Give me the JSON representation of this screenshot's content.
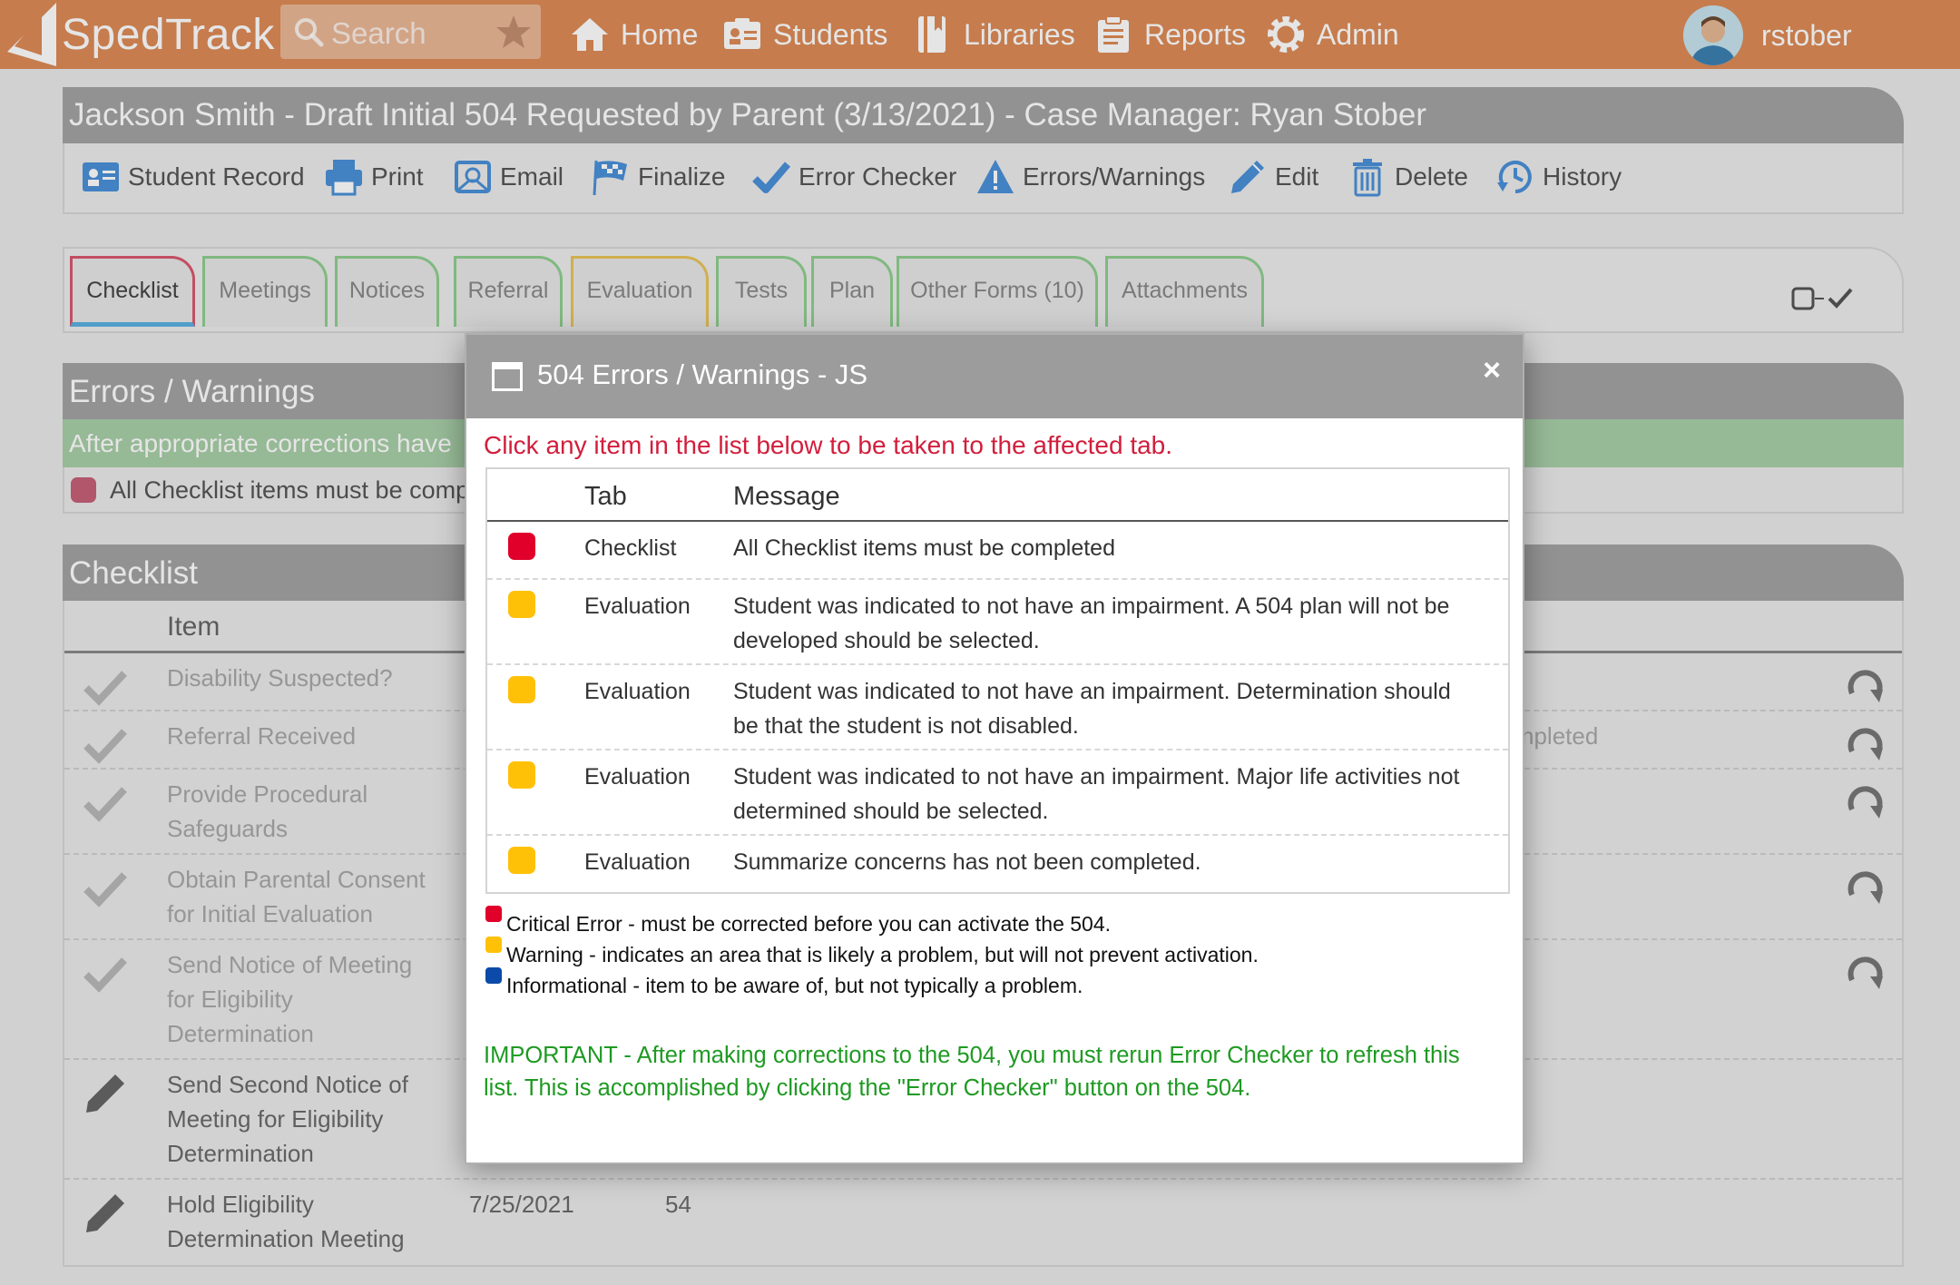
{
  "app": {
    "name": "SpedTrack",
    "search_placeholder": "Search",
    "nav": [
      {
        "label": "Home",
        "icon": "home-icon"
      },
      {
        "label": "Students",
        "icon": "students-icon"
      },
      {
        "label": "Libraries",
        "icon": "libraries-icon"
      },
      {
        "label": "Reports",
        "icon": "reports-icon"
      },
      {
        "label": "Admin",
        "icon": "admin-icon"
      }
    ],
    "user": "rstober"
  },
  "record": {
    "title": "Jackson Smith - Draft Initial 504 Requested by Parent (3/13/2021) - Case Manager: Ryan Stober",
    "toolbar": [
      {
        "label": "Student Record",
        "icon": "student-record-icon"
      },
      {
        "label": "Print",
        "icon": "print-icon"
      },
      {
        "label": "Email",
        "icon": "email-icon"
      },
      {
        "label": "Finalize",
        "icon": "finalize-flag-icon"
      },
      {
        "label": "Error Checker",
        "icon": "checkmark-icon"
      },
      {
        "label": "Errors/Warnings",
        "icon": "warning-icon"
      },
      {
        "label": "Edit",
        "icon": "pencil-icon"
      },
      {
        "label": "Delete",
        "icon": "trash-icon"
      },
      {
        "label": "History",
        "icon": "history-icon"
      }
    ],
    "tabs": [
      {
        "label": "Checklist",
        "state": "active"
      },
      {
        "label": "Meetings",
        "state": "complete"
      },
      {
        "label": "Notices",
        "state": "complete"
      },
      {
        "label": "Referral",
        "state": "complete"
      },
      {
        "label": "Evaluation",
        "state": "warning"
      },
      {
        "label": "Tests",
        "state": "complete"
      },
      {
        "label": "Plan",
        "state": "complete"
      },
      {
        "label": "Other Forms (10)",
        "state": "complete"
      },
      {
        "label": "Attachments",
        "state": "complete"
      }
    ]
  },
  "errors_panel": {
    "title": "Errors / Warnings",
    "green_text": "After appropriate corrections have",
    "item": "All Checklist items must be comp"
  },
  "checklist": {
    "title": "Checklist",
    "column_item": "Item",
    "rows": [
      {
        "text": "Disability Suspected?",
        "status": "done",
        "date": "",
        "days": "",
        "note": ""
      },
      {
        "text": "Referral Received",
        "status": "done",
        "date": "",
        "days": "",
        "note": "npleted"
      },
      {
        "text": "Provide Procedural Safeguards",
        "status": "done",
        "date": "",
        "days": "",
        "note": ""
      },
      {
        "text": "Obtain Parental Consent for Initial Evaluation",
        "status": "done",
        "date": "",
        "days": "",
        "note": ""
      },
      {
        "text": "Send Notice of Meeting for Eligibility Determination",
        "status": "done",
        "date": "",
        "days": "",
        "note": ""
      },
      {
        "text": "Send Second Notice of Meeting for Eligibility Determination",
        "status": "todo",
        "date": "",
        "days": "",
        "note": ""
      },
      {
        "text": "Hold Eligibility Determination Meeting",
        "status": "todo",
        "date": "7/25/2021",
        "days": "54",
        "note": ""
      }
    ]
  },
  "modal": {
    "title": "504 Errors / Warnings - JS",
    "close": "×",
    "instruction": "Click any item in the list below to be taken to the affected tab.",
    "columns": {
      "tab": "Tab",
      "message": "Message"
    },
    "rows": [
      {
        "severity": "critical",
        "color": "#e0002a",
        "tab": "Checklist",
        "message": "All Checklist items must be completed"
      },
      {
        "severity": "warning",
        "color": "#ffc107",
        "tab": "Evaluation",
        "message": "Student was indicated to not have an impairment. A 504 plan will not be developed should be selected."
      },
      {
        "severity": "warning",
        "color": "#ffc107",
        "tab": "Evaluation",
        "message": "Student was indicated to not have an impairment. Determination should be that the student is not disabled."
      },
      {
        "severity": "warning",
        "color": "#ffc107",
        "tab": "Evaluation",
        "message": "Student was indicated to not have an impairment. Major life activities not determined should be selected."
      },
      {
        "severity": "warning",
        "color": "#ffc107",
        "tab": "Evaluation",
        "message": "Summarize concerns has not been completed."
      }
    ],
    "legend": [
      {
        "color": "#e0002a",
        "text": "Critical Error - must be corrected before you can activate the 504."
      },
      {
        "color": "#ffc107",
        "text": "Warning - indicates an area that is likely a problem, but will not prevent activation."
      },
      {
        "color": "#0b4aa8",
        "text": "Informational - item to be aware of, but not typically a problem."
      }
    ],
    "important": "IMPORTANT - After making corrections to the 504, you must rerun Error Checker to refresh this list. This is accomplished by clicking the \"Error Checker\" button on the 504."
  },
  "colors": {
    "nav_orange": "#dd8b56",
    "header_gray": "#a3a3a3",
    "critical": "#e0002a",
    "warning": "#ffc107",
    "info": "#0b4aa8",
    "instruction_red": "#d21e3c",
    "important_green": "#1e9a22",
    "tab_border_green": "#8fcf8f",
    "tab_active_border": "#d9576e"
  }
}
